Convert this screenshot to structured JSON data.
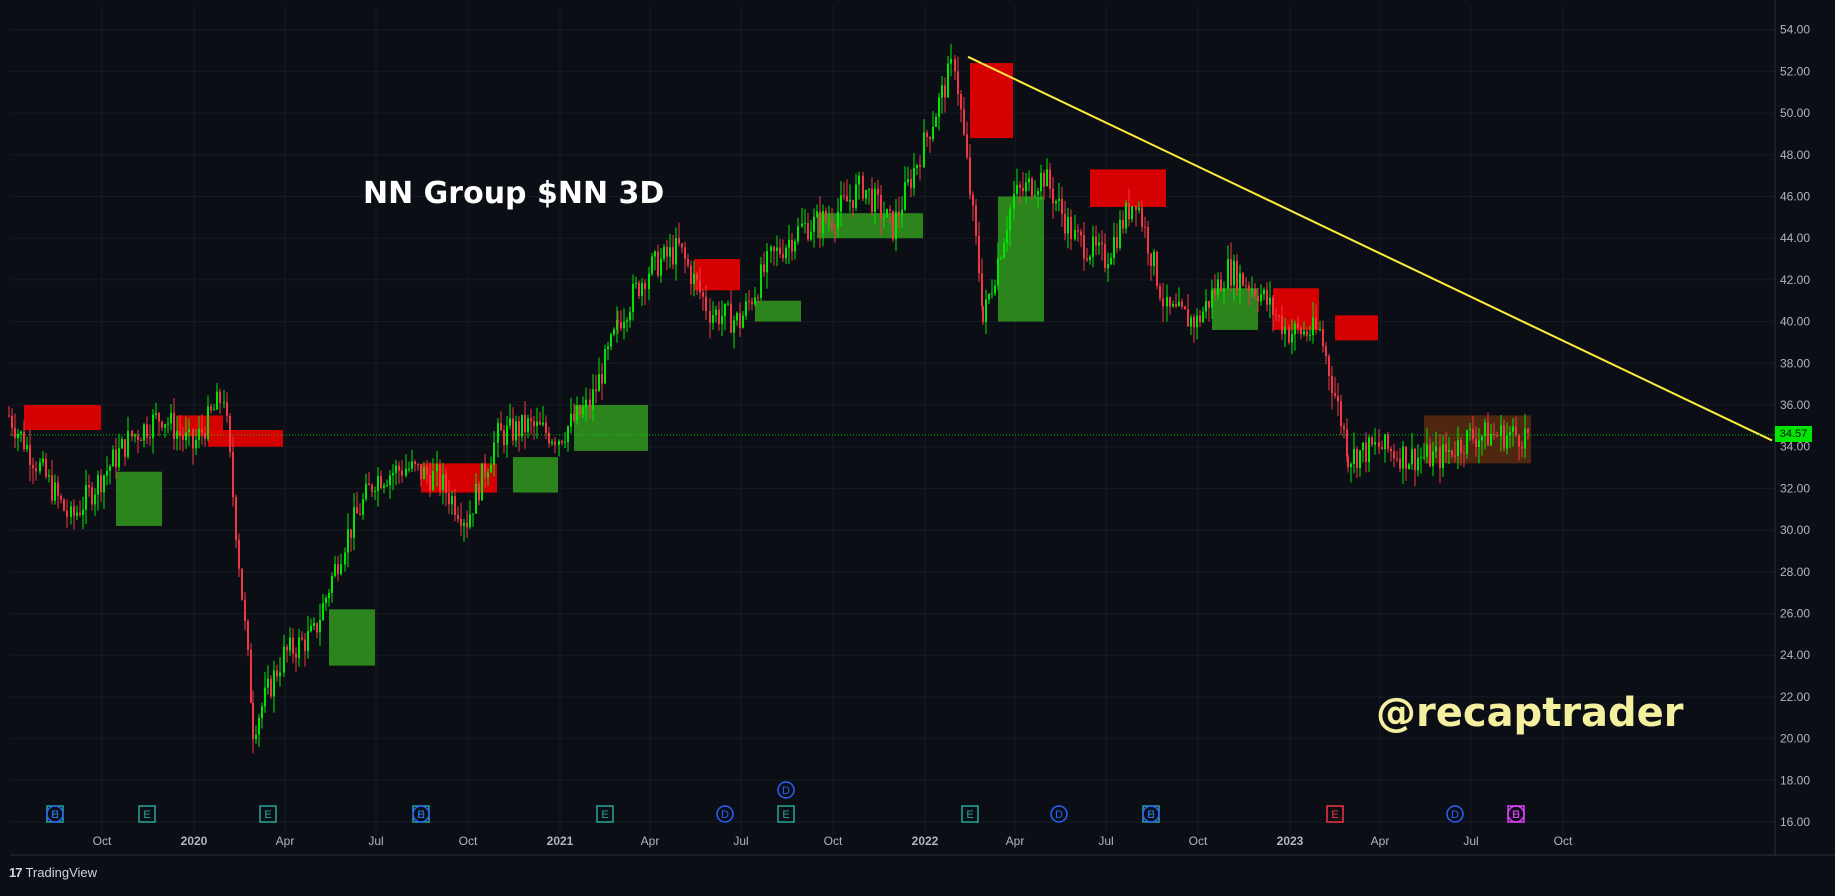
{
  "chart_data": {
    "type": "candlestick",
    "title": "NN Group $NN 3D",
    "watermark": "@recaptrader",
    "branding": "TradingView",
    "ylim": [
      15.0,
      55.0
    ],
    "y_ticks": [
      "54.00",
      "52.00",
      "50.00",
      "48.00",
      "46.00",
      "44.00",
      "42.00",
      "40.00",
      "38.00",
      "36.00",
      "34.00",
      "32.00",
      "30.00",
      "28.00",
      "26.00",
      "24.00",
      "22.00",
      "20.00",
      "18.00",
      "16.00"
    ],
    "x_ticks": [
      "Oct",
      "2020",
      "Apr",
      "Jul",
      "Oct",
      "2021",
      "Apr",
      "Jul",
      "Oct",
      "2022",
      "Apr",
      "Jul",
      "Oct",
      "2023",
      "Apr",
      "Jul",
      "Oct"
    ],
    "last_price": "34.57",
    "price_series_approx": [
      {
        "date": "2019-07",
        "close": 35.5
      },
      {
        "date": "2019-08",
        "close": 33.0
      },
      {
        "date": "2019-09",
        "close": 30.5
      },
      {
        "date": "2019-10",
        "close": 32.5
      },
      {
        "date": "2019-11",
        "close": 34.5
      },
      {
        "date": "2019-12",
        "close": 35.5
      },
      {
        "date": "2020-01",
        "close": 34.0
      },
      {
        "date": "2020-02",
        "close": 36.5
      },
      {
        "date": "2020-03",
        "close": 20.5
      },
      {
        "date": "2020-04",
        "close": 24.0
      },
      {
        "date": "2020-05",
        "close": 25.0
      },
      {
        "date": "2020-06",
        "close": 29.5
      },
      {
        "date": "2020-07",
        "close": 32.5
      },
      {
        "date": "2020-08",
        "close": 33.0
      },
      {
        "date": "2020-09",
        "close": 32.5
      },
      {
        "date": "2020-10",
        "close": 30.5
      },
      {
        "date": "2020-11",
        "close": 34.5
      },
      {
        "date": "2020-12",
        "close": 35.0
      },
      {
        "date": "2021-01",
        "close": 34.5
      },
      {
        "date": "2021-02",
        "close": 36.0
      },
      {
        "date": "2021-03",
        "close": 40.0
      },
      {
        "date": "2021-04",
        "close": 42.5
      },
      {
        "date": "2021-05",
        "close": 43.5
      },
      {
        "date": "2021-06",
        "close": 40.5
      },
      {
        "date": "2021-07",
        "close": 40.0
      },
      {
        "date": "2021-08",
        "close": 43.0
      },
      {
        "date": "2021-09",
        "close": 44.5
      },
      {
        "date": "2021-10",
        "close": 45.0
      },
      {
        "date": "2021-11",
        "close": 46.5
      },
      {
        "date": "2021-12",
        "close": 44.5
      },
      {
        "date": "2022-01",
        "close": 48.5
      },
      {
        "date": "2022-02",
        "close": 52.5
      },
      {
        "date": "2022-03",
        "close": 40.0
      },
      {
        "date": "2022-04",
        "close": 46.0
      },
      {
        "date": "2022-05",
        "close": 47.0
      },
      {
        "date": "2022-06",
        "close": 44.0
      },
      {
        "date": "2022-07",
        "close": 43.0
      },
      {
        "date": "2022-08",
        "close": 46.0
      },
      {
        "date": "2022-09",
        "close": 40.5
      },
      {
        "date": "2022-10",
        "close": 40.0
      },
      {
        "date": "2022-11",
        "close": 42.5
      },
      {
        "date": "2022-12",
        "close": 41.5
      },
      {
        "date": "2023-01",
        "close": 39.5
      },
      {
        "date": "2023-02",
        "close": 39.5
      },
      {
        "date": "2023-03",
        "close": 33.5
      },
      {
        "date": "2023-04",
        "close": 34.0
      },
      {
        "date": "2023-05",
        "close": 33.5
      },
      {
        "date": "2023-06",
        "close": 33.5
      },
      {
        "date": "2023-07",
        "close": 34.5
      },
      {
        "date": "2023-08",
        "close": 34.57
      }
    ],
    "zones": [
      {
        "start": "2019-07",
        "end": "2019-09",
        "low": 34.8,
        "high": 36.0,
        "color": "red"
      },
      {
        "start": "2019-10",
        "end": "2019-11",
        "low": 30.2,
        "high": 32.8,
        "color": "green"
      },
      {
        "start": "2019-12",
        "end": "2020-01",
        "low": 34.5,
        "high": 35.5,
        "color": "red"
      },
      {
        "start": "2020-01",
        "end": "2020-03",
        "low": 34.0,
        "high": 34.8,
        "color": "red"
      },
      {
        "start": "2020-05",
        "end": "2020-06",
        "low": 23.5,
        "high": 26.2,
        "color": "green"
      },
      {
        "start": "2020-08",
        "end": "2020-10",
        "low": 31.8,
        "high": 33.2,
        "color": "red"
      },
      {
        "start": "2020-11",
        "end": "2020-12",
        "low": 31.8,
        "high": 33.5,
        "color": "green"
      },
      {
        "start": "2021-01",
        "end": "2021-03",
        "low": 33.8,
        "high": 36.0,
        "color": "green"
      },
      {
        "start": "2021-05",
        "end": "2021-06",
        "low": 41.5,
        "high": 43.0,
        "color": "red"
      },
      {
        "start": "2021-07",
        "end": "2021-08",
        "low": 40.0,
        "high": 41.0,
        "color": "green"
      },
      {
        "start": "2021-09",
        "end": "2021-12",
        "low": 44.0,
        "high": 45.2,
        "color": "green"
      },
      {
        "start": "2022-02",
        "end": "2022-03",
        "low": 48.8,
        "high": 52.4,
        "color": "red"
      },
      {
        "start": "2022-03",
        "end": "2022-04",
        "low": 40.0,
        "high": 46.0,
        "color": "green"
      },
      {
        "start": "2022-06",
        "end": "2022-08",
        "low": 45.5,
        "high": 47.3,
        "color": "red"
      },
      {
        "start": "2022-10",
        "end": "2022-11",
        "low": 39.6,
        "high": 41.6,
        "color": "green"
      },
      {
        "start": "2022-12",
        "end": "2023-01",
        "low": 39.6,
        "high": 41.6,
        "color": "red"
      },
      {
        "start": "2023-02",
        "end": "2023-03",
        "low": 39.1,
        "high": 40.3,
        "color": "red"
      },
      {
        "start": "2023-05",
        "end": "2023-08",
        "low": 33.2,
        "high": 35.5,
        "color": "brown"
      }
    ],
    "trendline": {
      "start": {
        "date": "2022-03",
        "price": 52.7
      },
      "end": {
        "date": "2023-10",
        "price": 34.3
      },
      "color": "#ffeb3b"
    },
    "event_markers": [
      {
        "date": "2019-08",
        "label": "E",
        "color": "#26a69a"
      },
      {
        "date": "2019-08",
        "label": "D",
        "color": "#2962ff"
      },
      {
        "date": "2019-11",
        "label": "E",
        "color": "#26a69a"
      },
      {
        "date": "2020-03",
        "label": "E",
        "color": "#26a69a"
      },
      {
        "date": "2020-08",
        "label": "E",
        "color": "#26a69a"
      },
      {
        "date": "2020-08",
        "label": "D",
        "color": "#2962ff"
      },
      {
        "date": "2021-02",
        "label": "E",
        "color": "#26a69a"
      },
      {
        "date": "2021-06",
        "label": "D",
        "color": "#2962ff"
      },
      {
        "date": "2021-08",
        "label": "D",
        "color": "#2962ff",
        "row": 2
      },
      {
        "date": "2021-08",
        "label": "E",
        "color": "#26a69a"
      },
      {
        "date": "2022-02",
        "label": "E",
        "color": "#26a69a"
      },
      {
        "date": "2022-05",
        "label": "D",
        "color": "#2962ff"
      },
      {
        "date": "2022-08",
        "label": "E",
        "color": "#26a69a"
      },
      {
        "date": "2022-08",
        "label": "D",
        "color": "#2962ff"
      },
      {
        "date": "2023-02",
        "label": "E",
        "color": "#f23645"
      },
      {
        "date": "2023-06",
        "label": "D",
        "color": "#2962ff"
      },
      {
        "date": "2023-08",
        "label": "E",
        "color": "#e040fb"
      },
      {
        "date": "2023-08",
        "label": "D",
        "color": "#e040fb"
      }
    ],
    "colors": {
      "background": "#0b0e15",
      "up": "#00e600",
      "down": "#f23645",
      "zone_red": "#e00000",
      "zone_green": "#2e8b1e",
      "zone_brown": "#5c2a0e",
      "trendline": "#ffeb3b",
      "price_line": "#00e600"
    }
  }
}
